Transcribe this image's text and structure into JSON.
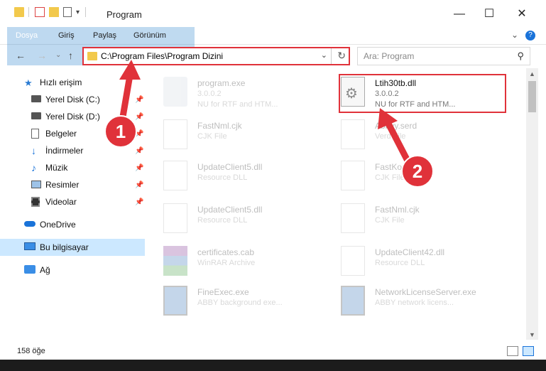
{
  "window": {
    "title": "Program",
    "minimize": "—",
    "maximize": "☐",
    "close": "✕"
  },
  "ribbon": {
    "file_tab": "Dosya",
    "tabs": [
      "Giriş",
      "Paylaş",
      "Görünüm"
    ],
    "expand_icon": "⌄",
    "help_icon": "?"
  },
  "nav": {
    "back": "←",
    "forward": "→",
    "recent": "⌄",
    "up": "↑",
    "address": "C:\\Program Files\\Program Dizini",
    "dropdown": "⌄",
    "refresh": "↻",
    "search_placeholder": "Ara: Program",
    "search_icon": "⚲"
  },
  "sidebar": {
    "items": [
      {
        "label": "Hızlı erişim",
        "icon": "star-icon",
        "pinned": false
      },
      {
        "label": "Yerel Disk (C:)",
        "icon": "drive-icon",
        "pinned": true
      },
      {
        "label": "Yerel Disk (D:)",
        "icon": "drive-icon",
        "pinned": true
      },
      {
        "label": "Belgeler",
        "icon": "document-icon",
        "pinned": true
      },
      {
        "label": "İndirmeler",
        "icon": "download-icon",
        "pinned": true
      },
      {
        "label": "Müzik",
        "icon": "music-icon",
        "pinned": true
      },
      {
        "label": "Resimler",
        "icon": "picture-icon",
        "pinned": true
      },
      {
        "label": "Videolar",
        "icon": "film-icon",
        "pinned": true
      },
      {
        "label": "OneDrive",
        "icon": "cloud-icon",
        "pinned": false
      },
      {
        "label": "Bu bilgisayar",
        "icon": "computer-icon",
        "pinned": false,
        "selected": true
      },
      {
        "label": "Ağ",
        "icon": "network-icon",
        "pinned": false
      }
    ],
    "pin_glyph": "📌"
  },
  "files": [
    {
      "name": "program.exe",
      "line1": "3.0.0.2",
      "line2": "NU for RTF and HTM...",
      "icon": "exe-icon"
    },
    {
      "name": "Ltih30tb.dll",
      "line1": "3.0.0.2",
      "line2": "NU for RTF and HTM...",
      "icon": "dll-gear-icon",
      "active": true
    },
    {
      "name": "FastNml.cjk",
      "line1": "CJK File",
      "line2": "",
      "icon": "blank-file-icon"
    },
    {
      "name": "Abbyy.serd",
      "line1": "Verd File",
      "line2": "",
      "icon": "blank-file-icon"
    },
    {
      "name": "UpdateClient5.dll",
      "line1": "Resource DLL",
      "line2": "",
      "icon": "dll-gear-icon"
    },
    {
      "name": "FastKor.cjk",
      "line1": "CJK File",
      "line2": "",
      "icon": "blank-file-icon"
    },
    {
      "name": "UpdateClient5.dll",
      "line1": "Resource DLL",
      "line2": "",
      "icon": "dll-gear-icon"
    },
    {
      "name": "FastNml.cjk",
      "line1": "CJK File",
      "line2": "",
      "icon": "blank-file-icon"
    },
    {
      "name": "certificates.cab",
      "line1": "WinRAR Archive",
      "line2": "",
      "icon": "archive-icon"
    },
    {
      "name": "UpdateClient42.dll",
      "line1": "Resource DLL",
      "line2": "",
      "icon": "dll-gear-icon"
    },
    {
      "name": "FineExec.exe",
      "line1": "ABBY background exe...",
      "line2": "",
      "icon": "exe-window-icon"
    },
    {
      "name": "NetworkLicenseServer.exe",
      "line1": "ABBY network licens...",
      "line2": "",
      "icon": "exe-window-icon"
    }
  ],
  "status": {
    "count": "158 öğe"
  },
  "annotations": {
    "badge1": "1",
    "badge2": "2",
    "color": "#e0323a"
  }
}
